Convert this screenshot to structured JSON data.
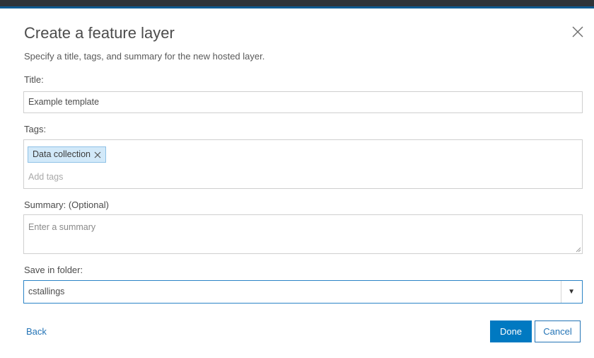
{
  "dialog": {
    "title": "Create a feature layer",
    "subtitle": "Specify a title, tags, and summary for the new hosted layer.",
    "close_icon": "close-icon"
  },
  "form": {
    "title_label": "Title:",
    "title_value": "Example template",
    "tags_label": "Tags:",
    "tags": [
      {
        "label": "Data collection"
      }
    ],
    "tags_placeholder": "Add tags",
    "summary_label": "Summary: (Optional)",
    "summary_placeholder": "Enter a summary",
    "folder_label": "Save in folder:",
    "folder_selected": "cstallings"
  },
  "footer": {
    "back_label": "Back",
    "done_label": "Done",
    "cancel_label": "Cancel"
  },
  "colors": {
    "accent": "#0079c1",
    "link": "#2474b6",
    "tag_bg": "#d2e9f9",
    "header_dark": "#2f3338",
    "header_blue": "#0f5a91"
  }
}
